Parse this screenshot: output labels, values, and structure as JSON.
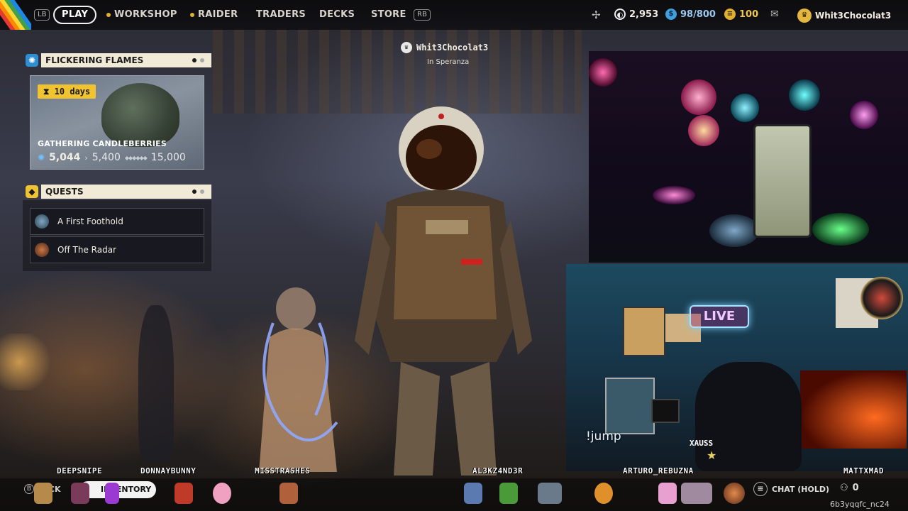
{
  "topbar": {
    "lb": "LB",
    "rb": "RB",
    "nav": [
      "PLAY",
      "WORKSHOP",
      "RAIDER",
      "TRADERS",
      "DECKS",
      "STORE"
    ],
    "credits": "2,953",
    "tokens": "98/800",
    "coins": "100",
    "username": "Whit3Chocolat3"
  },
  "season": {
    "title": "FLICKERING FLAMES",
    "days_left": "10 days",
    "event_title": "GATHERING CANDLEBERRIES",
    "current": "5,044",
    "next": "5,400",
    "max": "15,000",
    "progress_fraction": 0.336
  },
  "quests": {
    "title": "QUESTS",
    "items": [
      "A First Foothold",
      "Off The Radar"
    ]
  },
  "player": {
    "name": "Whit3Chocolat3",
    "location": "In Speranza"
  },
  "webcam": {
    "chat_command": "!jump",
    "chat_user": "XAUSS",
    "live_sign": "LIVE"
  },
  "viewers": [
    "DEEPSNIPE",
    "DONNAYBUNNY",
    "MISSTRASHES",
    "AL3KZ4ND3R",
    "ARTURO_REBUZNA",
    "MATTXMAD"
  ],
  "bottombar": {
    "back": "BACK",
    "inventory": "INVENTORY",
    "chat": "CHAT (HOLD)",
    "friends_count": "0",
    "user_tail": "6b3yqqfc_nc24"
  },
  "colors": {
    "accent_yellow": "#f0c330",
    "panel_cream": "#f1ead7",
    "credits_blue": "#3fa0e0",
    "coins_gold": "#e0b030"
  }
}
